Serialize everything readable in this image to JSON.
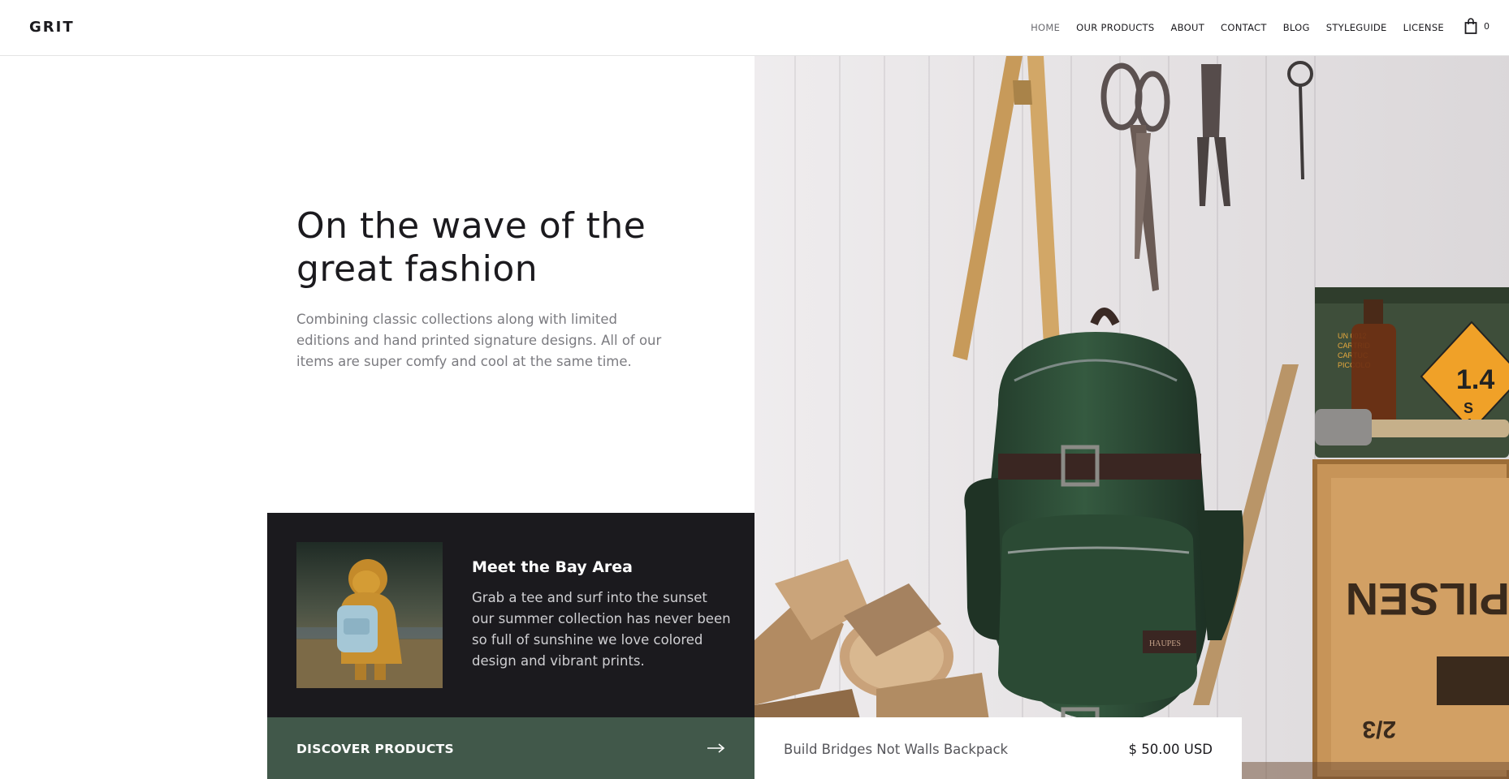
{
  "brand": {
    "logo": "GRIT"
  },
  "nav": {
    "items": [
      {
        "label": "HOME",
        "active": true
      },
      {
        "label": "OUR PRODUCTS",
        "active": false
      },
      {
        "label": "ABOUT",
        "active": false
      },
      {
        "label": "CONTACT",
        "active": false
      },
      {
        "label": "BLOG",
        "active": false
      },
      {
        "label": "STYLEGUIDE",
        "active": false
      },
      {
        "label": "LICENSE",
        "active": false
      }
    ],
    "cart_count": "0",
    "cart_icon": "shopping-bag-icon"
  },
  "hero": {
    "title_line1": "On the wave of the",
    "title_line2": "great fashion",
    "description": "Combining classic collections along with limited editions and hand printed signature designs. All of our items are super comfy and cool at the same time."
  },
  "feature": {
    "title": "Meet the Bay Area",
    "text": "Grab a tee and surf into the sunset our summer collection has never been so full of sunshine we love colored design and vibrant prints."
  },
  "cta": {
    "label": "DISCOVER PRODUCTS",
    "icon": "arrow-right-icon"
  },
  "product": {
    "name": "Build Bridges Not Walls Backpack",
    "price": "$ 50.00 USD"
  },
  "image_text": {
    "crate_word": "PILSEN",
    "crate_small": "2/3",
    "hazard_number": "1.4",
    "hazard_s": "S",
    "hazard_1": "1",
    "ammo_label1": "UN 0012",
    "ammo_label2": "CARTRID",
    "ammo_label3": "CARTUC",
    "ammo_label4": "PICCOLO",
    "patch": "HAUPES"
  },
  "colors": {
    "dark": "#1b1a1e",
    "green": "#41584a",
    "muted_text": "#7b7b80",
    "backpack": "#2f4a35"
  }
}
